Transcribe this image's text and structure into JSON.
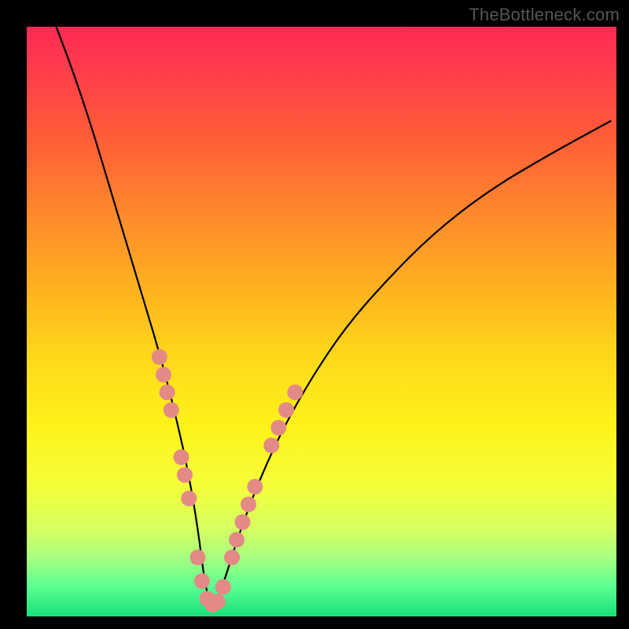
{
  "watermark": "TheBottleneck.com",
  "chart_data": {
    "type": "line",
    "title": "",
    "xlabel": "",
    "ylabel": "",
    "xlim": [
      0,
      100
    ],
    "ylim": [
      0,
      100
    ],
    "x_min_at": 31,
    "curve": {
      "x": [
        5,
        8,
        11,
        14,
        17,
        20,
        23,
        25.5,
        27.5,
        29,
        30,
        31,
        32,
        33.5,
        36,
        39,
        43,
        48,
        54,
        61,
        69,
        78,
        88,
        99
      ],
      "y": [
        100,
        92,
        83,
        73,
        63,
        53,
        43,
        33,
        24,
        15,
        7,
        2,
        2,
        6,
        14,
        22,
        31,
        40,
        49,
        57,
        65,
        72,
        78,
        84
      ]
    },
    "marker_groups": [
      {
        "name": "left-cluster-upper",
        "points": [
          {
            "x": 22.5,
            "y": 44
          },
          {
            "x": 23.2,
            "y": 41
          },
          {
            "x": 23.8,
            "y": 38
          },
          {
            "x": 24.5,
            "y": 35
          }
        ]
      },
      {
        "name": "left-cluster-lower",
        "points": [
          {
            "x": 26.2,
            "y": 27
          },
          {
            "x": 26.8,
            "y": 24
          },
          {
            "x": 27.5,
            "y": 20
          }
        ]
      },
      {
        "name": "bottom-cluster",
        "points": [
          {
            "x": 29.0,
            "y": 10
          },
          {
            "x": 29.7,
            "y": 6
          },
          {
            "x": 30.6,
            "y": 3
          },
          {
            "x": 31.5,
            "y": 2
          },
          {
            "x": 32.4,
            "y": 2.5
          },
          {
            "x": 33.3,
            "y": 5
          }
        ]
      },
      {
        "name": "right-cluster-lower",
        "points": [
          {
            "x": 34.8,
            "y": 10
          },
          {
            "x": 35.6,
            "y": 13
          },
          {
            "x": 36.6,
            "y": 16
          },
          {
            "x": 37.6,
            "y": 19
          },
          {
            "x": 38.7,
            "y": 22
          }
        ]
      },
      {
        "name": "right-cluster-upper",
        "points": [
          {
            "x": 41.5,
            "y": 29
          },
          {
            "x": 42.7,
            "y": 32
          },
          {
            "x": 44.0,
            "y": 35
          },
          {
            "x": 45.5,
            "y": 38
          }
        ]
      }
    ]
  }
}
